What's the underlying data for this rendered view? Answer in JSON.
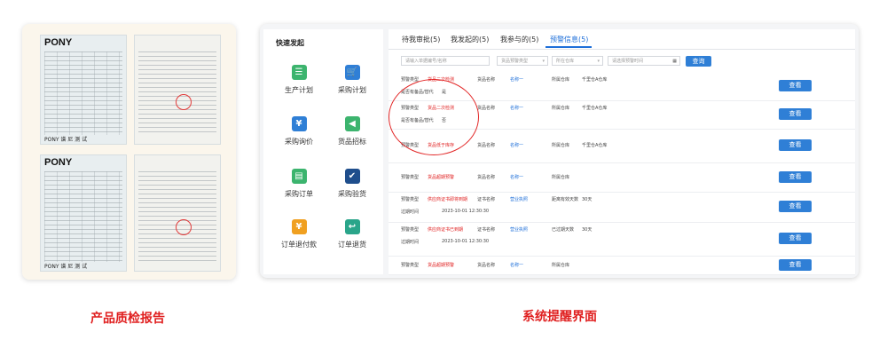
{
  "left_panel": {
    "caption": "产品质检报告",
    "docs": [
      {
        "logo": "PONY",
        "footer": "PONY 谱 尼 测 试"
      },
      {
        "logo": "",
        "footer": ""
      },
      {
        "logo": "PONY",
        "footer": "PONY 谱 尼 测 试"
      },
      {
        "logo": "",
        "footer": ""
      }
    ]
  },
  "right_panel": {
    "caption": "系统提醒界面",
    "quick_title": "快速发起",
    "quick_items": [
      {
        "label": "生产计划",
        "icon": "production-plan-icon",
        "color": "#3cb46e",
        "glyph": "☰"
      },
      {
        "label": "采购计划",
        "icon": "purchase-plan-icon",
        "color": "#2f7fd6",
        "glyph": "🛒"
      },
      {
        "label": "采购询价",
        "icon": "inquiry-icon",
        "color": "#2f7fd6",
        "glyph": "¥"
      },
      {
        "label": "货品招标",
        "icon": "bidding-icon",
        "color": "#3cb46e",
        "glyph": "◀"
      },
      {
        "label": "采购订单",
        "icon": "purchase-order-icon",
        "color": "#3cb46e",
        "glyph": "▤"
      },
      {
        "label": "采购验货",
        "icon": "inspection-icon",
        "color": "#1f4e8c",
        "glyph": "✔"
      },
      {
        "label": "订单退付款",
        "icon": "refund-icon",
        "color": "#f0a020",
        "glyph": "¥"
      },
      {
        "label": "订单退货",
        "icon": "return-icon",
        "color": "#2aa58a",
        "glyph": "↩"
      }
    ],
    "tabs": [
      "待我审批(5)",
      "我发起的(5)",
      "我参与的(5)",
      "预警信息(5)"
    ],
    "active_tab": 3,
    "filters": {
      "search_placeholder": "请输入单据编号/名称",
      "type_placeholder": "货品预警类型",
      "warehouse_placeholder": "所在仓库",
      "date_placeholder": "请选择预警时间",
      "query_label": "查询"
    },
    "rows": [
      {
        "l1": "预警类型",
        "v1": "货品二次检测",
        "l2": "是否有备品/替代",
        "v2": "是",
        "c1": "货品名称",
        "c1v": "名称一",
        "c2": "所属仓库",
        "c3": "千里仓A仓库",
        "btn": "查看"
      },
      {
        "l1": "预警类型",
        "v1": "货品二次检测",
        "l2": "是否有备品/替代",
        "v2": "否",
        "c1": "货品名称",
        "c1v": "名称一",
        "c2": "所属仓库",
        "c3": "千里仓A仓库",
        "btn": "查看"
      },
      {
        "l1": "预警类型",
        "v1": "货品低于库存",
        "l2": "",
        "v2": "",
        "c1": "货品名称",
        "c1v": "名称一",
        "c2": "所属仓库",
        "c3": "千里仓A仓库",
        "btn": "查看"
      },
      {
        "l1": "预警类型",
        "v1": "货品超期预警",
        "l2": "",
        "v2": "",
        "c1": "货品名称",
        "c1v": "名称一",
        "c2": "所属仓库",
        "c3": "",
        "btn": "查看"
      },
      {
        "l1": "预警类型",
        "v1": "供应商证书即将到期",
        "l2": "过期时间",
        "v2": "2023-10-01 12:30:30",
        "c1": "证书名称",
        "c1v": "营业执照",
        "c2": "距离有效天数",
        "c3": "30天",
        "btn": "查看"
      },
      {
        "l1": "预警类型",
        "v1": "供应商证书已到期",
        "l2": "过期时间",
        "v2": "2023-10-01 12:30:30",
        "c1": "证书名称",
        "c1v": "营业执照",
        "c2": "已过期天数",
        "c3": "30天",
        "btn": "查看"
      },
      {
        "l1": "预警类型",
        "v1": "货品超期预警",
        "l2": "",
        "v2": "",
        "c1": "货品名称",
        "c1v": "名称一",
        "c2": "所属仓库",
        "c3": "",
        "btn": "查看"
      }
    ]
  }
}
